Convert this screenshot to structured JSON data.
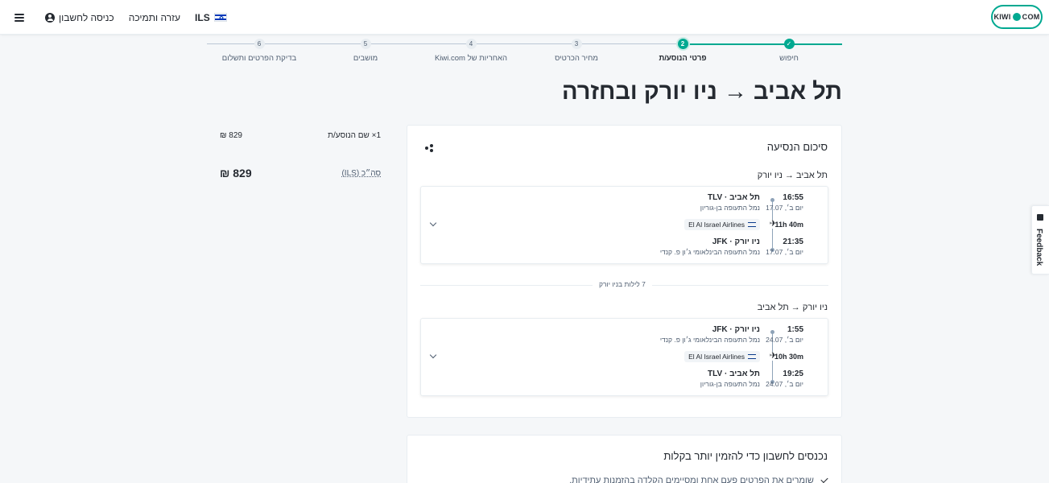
{
  "header": {
    "logo_text_left": "KIWI",
    "logo_text_right": "COM",
    "currency": "ILS",
    "help": "עזרה ותמיכה",
    "login": "כניסה לחשבון"
  },
  "stepper": {
    "steps": [
      {
        "num": "✓",
        "label": "חיפוש"
      },
      {
        "num": "2",
        "label": "פרטי הנוסע/ת"
      },
      {
        "num": "3",
        "label": "מחיר הכרטיס"
      },
      {
        "num": "4",
        "label": "האחריות של Kiwi.com"
      },
      {
        "num": "5",
        "label": "מושבים"
      },
      {
        "num": "6",
        "label": "בדיקת הפרטים ותשלום"
      }
    ]
  },
  "page_title": "תל אביב → ניו יורק ובחזרה",
  "price": {
    "passenger_label": "1× שם הנוסע/ת",
    "passenger_price": "829 ₪",
    "total_label": "סה״כ (ILS)",
    "total_value": "829 ₪"
  },
  "trip": {
    "title": "סיכום הנסיעה",
    "outbound": {
      "title": "תל אביב → ניו יורק",
      "dep_time": "16:55",
      "dep_day": "יום ב׳, 17.07",
      "dep_city": "תל אביב · TLV",
      "dep_airport": "נמל התעופה בן-גוריון",
      "airline": "El Al Israel Airlines",
      "duration": "11h 40m",
      "arr_time": "21:35",
      "arr_day": "יום ב׳, 17.07",
      "arr_city": "ניו יורק · JFK",
      "arr_airport": "נמל התעופה הבינלאומי ג׳ון פ. קנדי"
    },
    "nights": "7 לילות בניו יורק",
    "inbound": {
      "title": "ניו יורק → תל אביב",
      "dep_time": "1:55",
      "dep_day": "יום ב׳, 24.07",
      "dep_city": "ניו יורק · JFK",
      "dep_airport": "נמל התעופה הבינלאומי ג׳ון פ. קנדי",
      "airline": "El Al Israel Airlines",
      "duration": "10h 30m",
      "arr_time": "19:25",
      "arr_day": "יום ב׳, 24.07",
      "arr_city": "תל אביב · TLV",
      "arr_airport": "נמל התעופה בן-גוריון"
    }
  },
  "account": {
    "title": "נכנסים לחשבון כדי להזמין יותר בקלות",
    "item": "שומרים את הפרטים פעם אחת ומסיימים הקלדה בהזמנות עתידיות."
  },
  "feedback": "Feedback"
}
